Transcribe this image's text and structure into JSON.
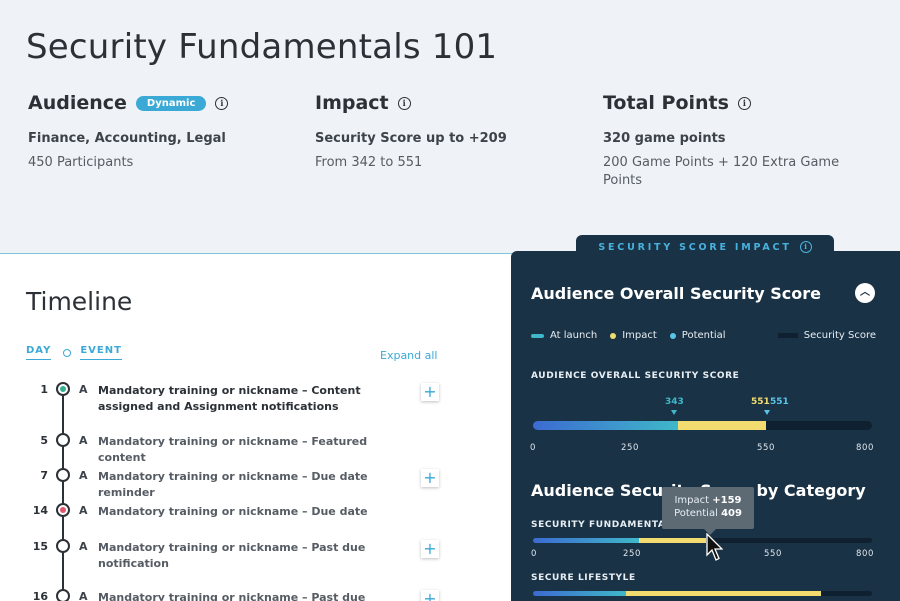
{
  "page_title": "Security Fundamentals 101",
  "audience": {
    "title": "Audience",
    "badge": "Dynamic",
    "sub": "Finance, Accounting, Legal",
    "text": "450 Participants"
  },
  "impact": {
    "title": "Impact",
    "sub": "Security Score up to +209",
    "text": "From 342 to 551"
  },
  "points": {
    "title": "Total Points",
    "sub": "320 game points",
    "text": "200 Game Points + 120 Extra Game Points"
  },
  "timeline": {
    "title": "Timeline",
    "col_day": "DAY",
    "col_event": "EVENT",
    "expand_all": "Expand all",
    "rows": [
      {
        "day": "1",
        "a": "A",
        "event": "Mandatory training or nickname – Content assigned and Assignment notifications",
        "status": "complete",
        "has_add": true
      },
      {
        "day": "5",
        "a": "A",
        "event": "Mandatory training or nickname – Featured content",
        "status": "pending",
        "has_add": false
      },
      {
        "day": "7",
        "a": "A",
        "event": "Mandatory training or nickname – Due date reminder",
        "status": "pending",
        "has_add": true
      },
      {
        "day": "14",
        "a": "A",
        "event": "Mandatory training or nickname – Due date",
        "status": "alert",
        "has_add": false
      },
      {
        "day": "15",
        "a": "A",
        "event": "Mandatory training or nickname – Past due notification",
        "status": "pending",
        "has_add": true
      },
      {
        "day": "16",
        "a": "A",
        "event": "Mandatory training or nickname – Past due",
        "status": "pending",
        "has_add": true
      }
    ]
  },
  "panel": {
    "tab_label": "SECURITY SCORE IMPACT",
    "title": "Audience Overall Security Score",
    "legend": {
      "at_launch": "At launch",
      "impact": "Impact",
      "potential": "Potential",
      "security_score": "Security Score"
    },
    "overall": {
      "label": "AUDIENCE OVERALL SECURITY SCORE",
      "at_launch": 343,
      "impact_to": 551,
      "potential": 551,
      "max": 800,
      "marker_launch": "343",
      "marker_impact": "551",
      "marker_potential": "551",
      "ticks": [
        "0",
        "250",
        "550",
        "800"
      ]
    },
    "category_title": "Audience Security Score by Category",
    "categories": [
      {
        "label": "SECURITY FUNDAMENTALS",
        "at_launch": 250,
        "impact_to": 409,
        "potential": 409,
        "max": 800,
        "ticks": [
          "0",
          "250",
          "550",
          "800"
        ]
      },
      {
        "label": "SECURE LIFESTYLE",
        "at_launch": 220,
        "impact_to": 680,
        "potential": 650,
        "max": 800
      }
    ],
    "tooltip": {
      "impact_label": "Impact",
      "impact_value": "+159",
      "potential_label": "Potential",
      "potential_value": "409"
    }
  },
  "colors": {
    "accent": "#3aa9d6",
    "panel_bg": "#1a3245",
    "at_launch": "#3fb8c9",
    "impact": "#f2dc6f",
    "potential": "#58c4e6",
    "alert": "#e45669",
    "complete": "#33b191"
  }
}
